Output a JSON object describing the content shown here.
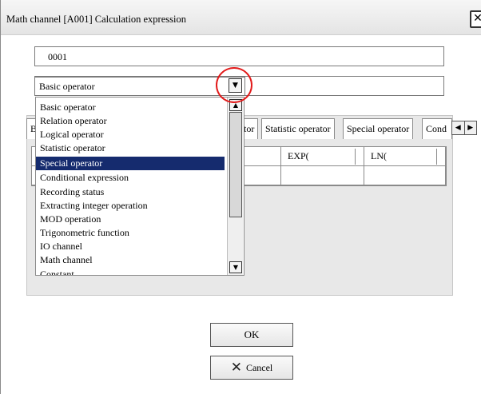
{
  "window": {
    "title": "Math channel [A001] Calculation expression",
    "close_glyph": "✕"
  },
  "channel_field": {
    "value": "0001"
  },
  "operator_select": {
    "selected": "Basic operator",
    "options": [
      "Basic operator",
      "Relation operator",
      "Logical operator",
      "Statistic operator",
      "Special operator",
      "Conditional expression",
      "Recording status",
      "Extracting integer operation",
      "MOD operation",
      "Trigonometric function",
      "IO channel",
      "Math channel",
      "Constant"
    ],
    "highlighted_index": 4
  },
  "tabs": {
    "visible_labels": [
      "B",
      "tor",
      "Statistic operator",
      "Special operator",
      "Cond"
    ],
    "prev_glyph": "◀",
    "next_glyph": "▶"
  },
  "operators": {
    "cells": [
      "EXP(",
      "LN("
    ]
  },
  "buttons": {
    "ok_label": "OK",
    "cancel_label": "Cancel",
    "cancel_icon": "x-icon"
  },
  "glyphs": {
    "combo_arrow": "▼",
    "scroll_up": "▲",
    "scroll_down": "▼"
  },
  "colors": {
    "selection": "#152b6e",
    "callout": "#e21b1b",
    "panel": "#e8e8e8"
  }
}
